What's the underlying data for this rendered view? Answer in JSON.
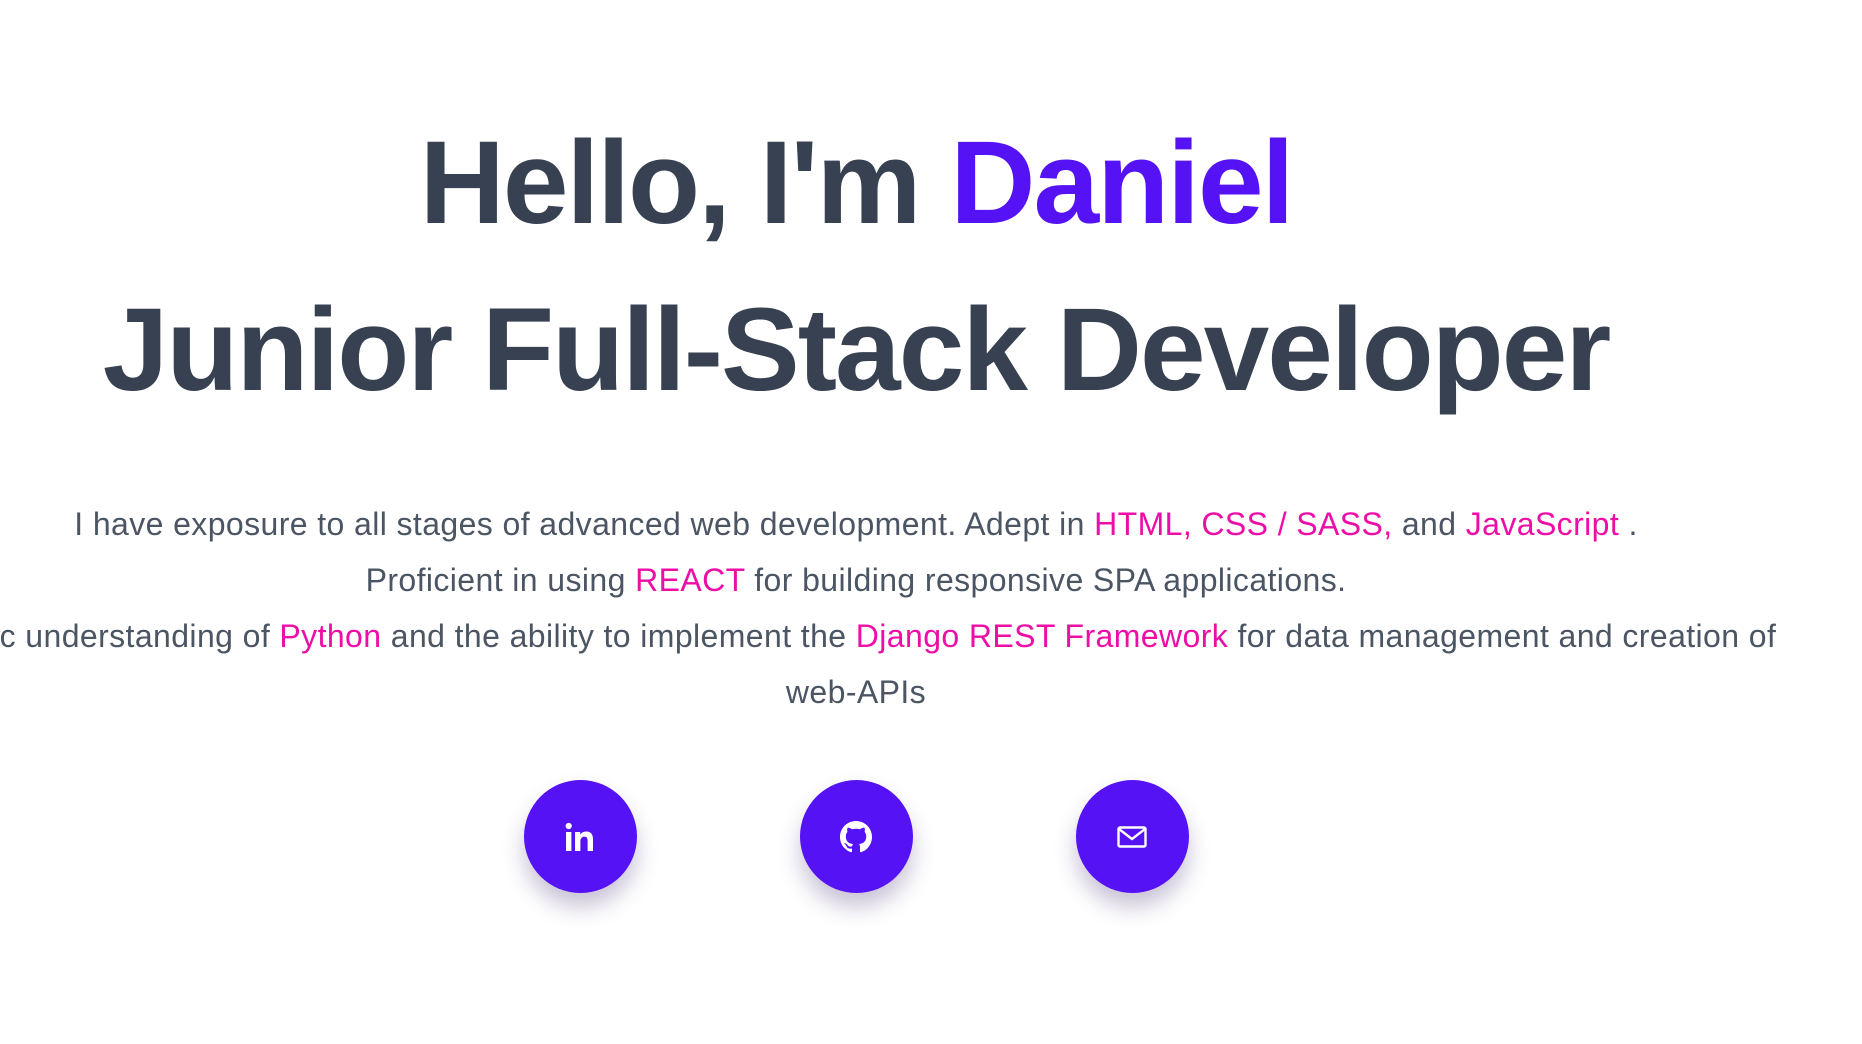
{
  "hero": {
    "greeting": "Hello, I'm",
    "name": "Daniel",
    "title": "Junior Full-Stack Developer"
  },
  "intro": {
    "line1": {
      "pre": "I have exposure to all stages of advanced web development. Adept in",
      "hl1": "HTML, CSS / SASS,",
      "mid": "and",
      "hl2": "JavaScript",
      "post": "."
    },
    "line2": {
      "pre": "Proficient in using",
      "hl": "REACT",
      "post": "for building responsive SPA applications."
    },
    "line3": {
      "pre": "Basic understanding of",
      "hl1": "Python",
      "mid": "and the ability to implement the",
      "hl2": "Django REST Framework",
      "post": "for data management and creation of web-APIs"
    }
  },
  "socials": [
    {
      "icon": "linkedin-icon"
    },
    {
      "icon": "github-icon"
    },
    {
      "icon": "mail-icon"
    }
  ],
  "colors": {
    "accent": "#5512f5",
    "highlight": "#ed0ea8",
    "heading": "#374151",
    "body": "#4b5563"
  }
}
